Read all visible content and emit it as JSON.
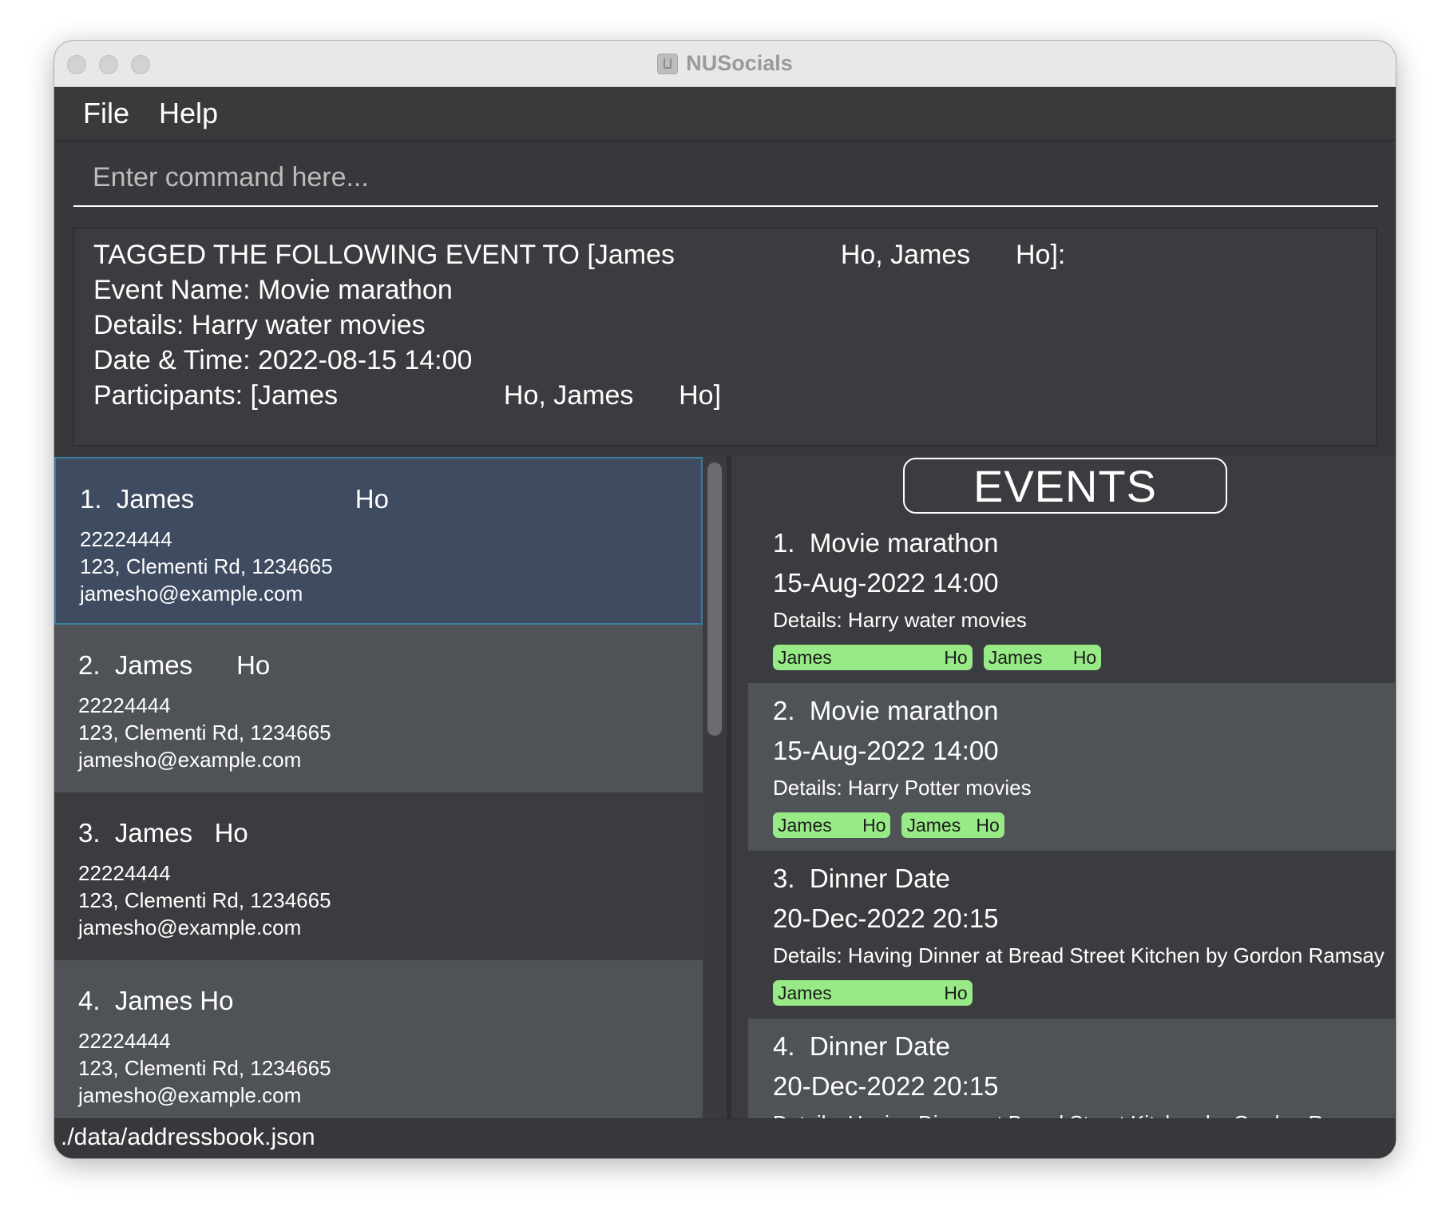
{
  "window": {
    "title": "NUSocials"
  },
  "menu": {
    "file": "File",
    "help": "Help"
  },
  "command": {
    "placeholder": "Enter command here...",
    "value": ""
  },
  "result": {
    "lines": [
      "TAGGED THE FOLLOWING EVENT TO [James                      Ho, James      Ho]:",
      "Event Name: Movie marathon",
      "Details: Harry water movies",
      "Date & Time: 2022-08-15 14:00",
      "Participants: [James                      Ho, James      Ho]"
    ]
  },
  "persons": [
    {
      "index": "1.",
      "name": "James                      Ho",
      "phone": "22224444",
      "address": "123, Clementi Rd, 1234665",
      "email": "jamesho@example.com"
    },
    {
      "index": "2.",
      "name": "James      Ho",
      "phone": "22224444",
      "address": "123, Clementi Rd, 1234665",
      "email": "jamesho@example.com"
    },
    {
      "index": "3.",
      "name": "James   Ho",
      "phone": "22224444",
      "address": "123, Clementi Rd, 1234665",
      "email": "jamesho@example.com"
    },
    {
      "index": "4.",
      "name": "James Ho",
      "phone": "22224444",
      "address": "123, Clementi Rd, 1234665",
      "email": "jamesho@example.com"
    }
  ],
  "events_panel": {
    "header": "EVENTS",
    "events": [
      {
        "index": "1.",
        "name": "Movie marathon",
        "datetime": "15-Aug-2022 14:00",
        "details": "Details: Harry water movies",
        "tags": [
          "James                      Ho",
          "James      Ho"
        ]
      },
      {
        "index": "2.",
        "name": "Movie marathon",
        "datetime": "15-Aug-2022 14:00",
        "details": "Details: Harry Potter movies",
        "tags": [
          "James      Ho",
          "James   Ho"
        ]
      },
      {
        "index": "3.",
        "name": "Dinner Date",
        "datetime": "20-Dec-2022 20:15",
        "details": "Details: Having Dinner at Bread Street Kitchen by Gordon Ramsay",
        "tags": [
          "James                      Ho"
        ]
      },
      {
        "index": "4.",
        "name": "Dinner Date",
        "datetime": "20-Dec-2022 20:15",
        "details": "Details: Having Dinner at Bread Street Kitchen by Gordon Ramsay",
        "tags": []
      }
    ]
  },
  "status": {
    "file_path": "./data/addressbook.json"
  },
  "colors": {
    "tag_bg": "#97ea86",
    "selected_bg": "#3f4b60",
    "selected_border": "#3c7aa0",
    "panel_bg": "#3b3c3f",
    "alt_row_bg": "#4f5256"
  }
}
